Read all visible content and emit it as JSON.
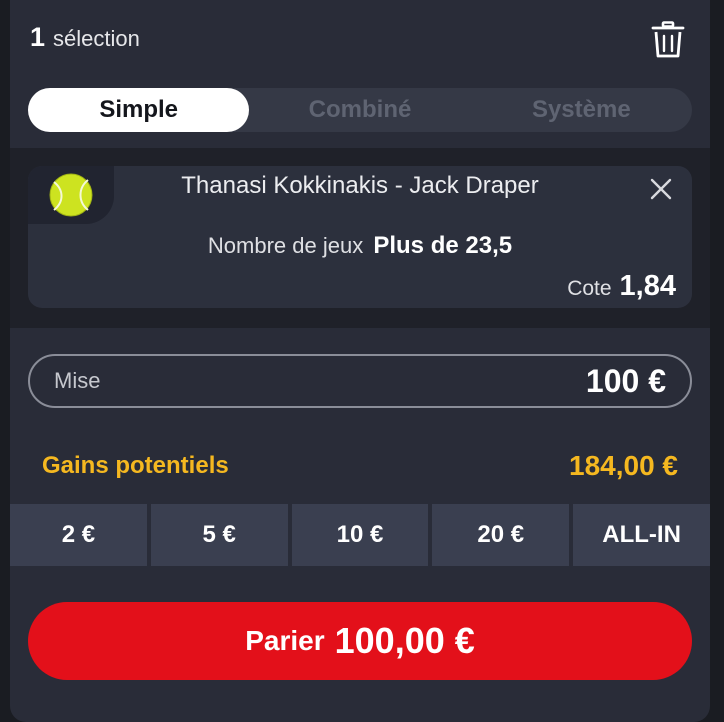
{
  "header": {
    "selection_count": "1",
    "selection_label": "sélection"
  },
  "icons": {
    "trash": "trash-icon",
    "tennis_ball": "tennis-ball-icon",
    "close": "close-icon"
  },
  "tabs": [
    {
      "label": "Simple",
      "active": true
    },
    {
      "label": "Combiné",
      "active": false
    },
    {
      "label": "Système",
      "active": false
    }
  ],
  "bet": {
    "match": "Thanasi Kokkinakis - Jack Draper",
    "market": "Nombre de jeux",
    "pick": "Plus de 23,5",
    "odds_label": "Cote",
    "odds_value": "1,84"
  },
  "stake": {
    "label": "Mise",
    "value": "100 €"
  },
  "gains": {
    "label": "Gains potentiels",
    "value": "184,00 €"
  },
  "quick_stakes": [
    "2 €",
    "5 €",
    "10 €",
    "20 €",
    "ALL-IN"
  ],
  "submit": {
    "label": "Parier",
    "amount": "100,00 €"
  },
  "colors": {
    "accent_red": "#e3101a",
    "gains_yellow": "#f5b820",
    "panel": "#292c38",
    "ball": "#cde320"
  }
}
